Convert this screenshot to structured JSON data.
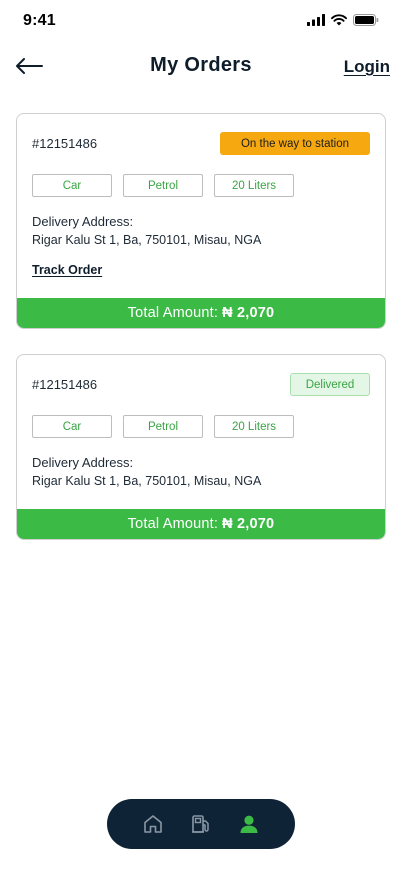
{
  "status_bar": {
    "time": "9:41"
  },
  "header": {
    "title": "My Orders",
    "login_label": "Login"
  },
  "orders": [
    {
      "id": "#12151486",
      "status": "On the way to station",
      "status_color": "#f6a811",
      "tags": [
        "Car",
        "Petrol",
        "20 Liters"
      ],
      "address_label": "Delivery Address:",
      "address": "Rigar Kalu St 1, Ba, 750101, Misau, NGA",
      "track_label": "Track Order",
      "total_label": "Total Amount:",
      "total_amount": "₦ 2,070"
    },
    {
      "id": "#12151486",
      "status": "Delivered",
      "status_color": "#3aa443",
      "tags": [
        "Car",
        "Petrol",
        "20 Liters"
      ],
      "address_label": "Delivery Address:",
      "address": "Rigar Kalu St 1, Ba, 750101, Misau, NGA",
      "total_label": "Total Amount:",
      "total_amount": "₦ 2,070"
    }
  ],
  "bottom_nav": {
    "items": [
      {
        "icon": "home-icon",
        "active": false
      },
      {
        "icon": "fuel-pump-icon",
        "active": false
      },
      {
        "icon": "user-icon",
        "active": true
      }
    ],
    "active_color": "#3cba46",
    "inactive_color": "#8a97a5"
  },
  "colors": {
    "accent_green": "#3cba46",
    "navy": "#0f2336",
    "warning": "#f6a811"
  }
}
